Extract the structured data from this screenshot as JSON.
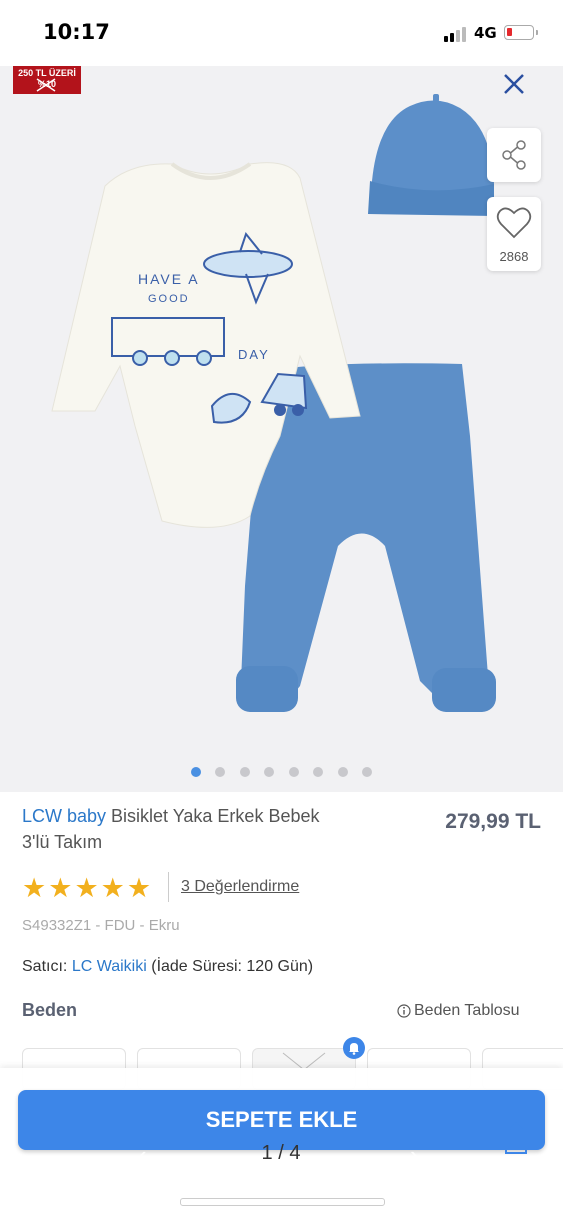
{
  "status_bar": {
    "time": "10:17",
    "network": "4G"
  },
  "gallery": {
    "promo_line1": "250 TL ÜZERİ",
    "promo_line2": "%10",
    "favorite_count": "2868",
    "dot_count": 8,
    "active_dot": 0,
    "image_text": [
      "HAVE A",
      "GOOD",
      "DAY"
    ]
  },
  "product": {
    "brand": "LCW baby",
    "name": " Bisiklet Yaka Erkek Bebek 3'lü Takım",
    "price": "279,99 TL",
    "rating_stars": 5,
    "reviews": "3 Değerlendirme",
    "sku": "S49332Z1 - FDU - Ekru",
    "seller_label": "Satıcı:",
    "seller_name": "LC Waikiki",
    "return_info": "(İade Süresi: 120 Gün)",
    "size_label": "Beden",
    "size_table_label": "Beden Tablosu"
  },
  "bottom": {
    "add_to_cart": "SEPETE EKLE",
    "pager": "1 / 4"
  },
  "colors": {
    "accent": "#3d86e8",
    "brand": "#2b78c9",
    "star": "#f2b01e",
    "promo": "#b3131b"
  }
}
